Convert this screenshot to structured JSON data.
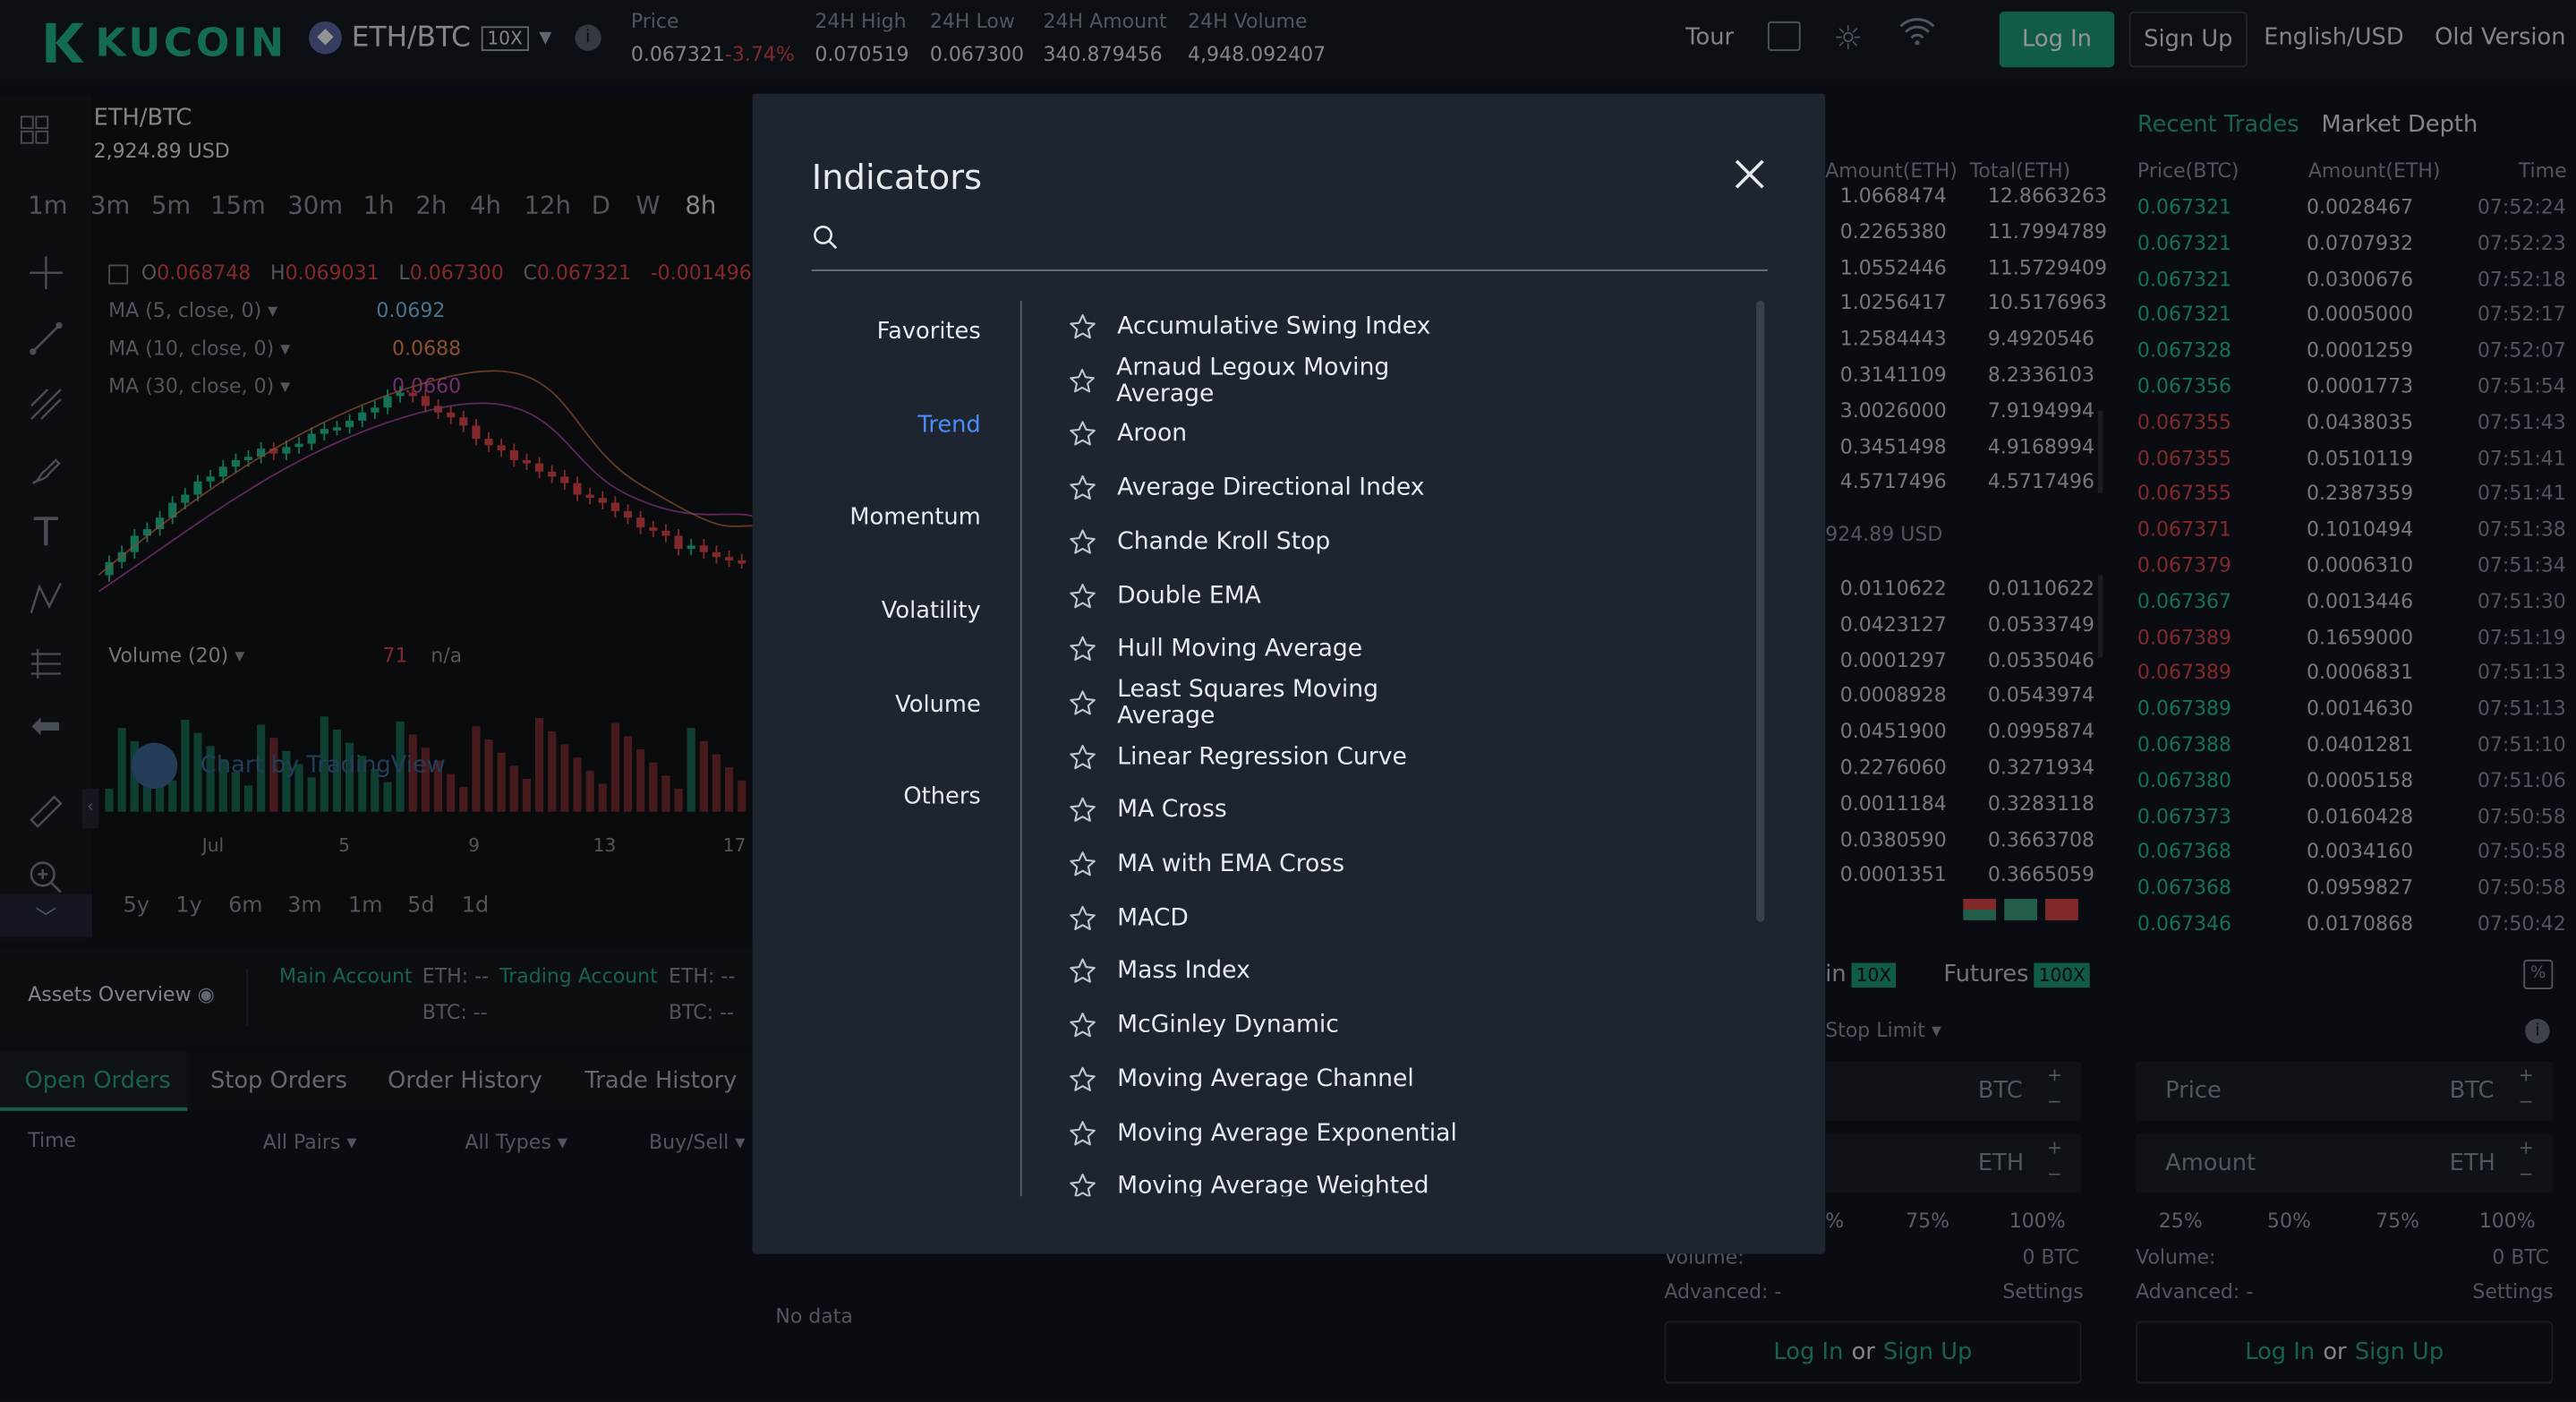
{
  "header": {
    "logo": "KUCOIN",
    "pair": "ETH/BTC",
    "leverage": "10X",
    "stats": [
      {
        "label": "Price",
        "value": "0.067321",
        "extra": "-3.74%"
      },
      {
        "label": "24H High",
        "value": "0.070519"
      },
      {
        "label": "24H Low",
        "value": "0.067300"
      },
      {
        "label": "24H Amount",
        "value": "340.879456"
      },
      {
        "label": "24H Volume",
        "value": "4,948.092407"
      }
    ],
    "tour": "Tour",
    "login": "Log In",
    "signup": "Sign Up",
    "language": "English/USD",
    "old_version": "Old Version"
  },
  "chart": {
    "pair": "ETH/BTC",
    "usd": "2,924.89 USD",
    "timeframes": [
      "1m",
      "3m",
      "5m",
      "15m",
      "30m",
      "1h",
      "2h",
      "4h",
      "12h",
      "D",
      "W",
      "8h"
    ],
    "ohlc": {
      "o": "0.068748",
      "h": "0.069031",
      "l": "0.067300",
      "c": "0.067321",
      "chg": "-0.001496 ("
    },
    "ma": [
      {
        "label": "MA (5, close, 0)",
        "value": "0.0692"
      },
      {
        "label": "MA (10, close, 0)",
        "value": "0.0688"
      },
      {
        "label": "MA (30, close, 0)",
        "value": "0.0660"
      }
    ],
    "volume_label": "Volume (20)",
    "volume_value": "71",
    "volume_na": "n/a",
    "watermark": "Chart by TradingView",
    "x_ticks": [
      "Jul",
      "5",
      "9",
      "13",
      "17"
    ],
    "ranges": [
      "5y",
      "1y",
      "6m",
      "3m",
      "1m",
      "5d",
      "1d"
    ]
  },
  "assets": {
    "overview": "Assets Overview",
    "main_account": "Main Account",
    "trading_account": "Trading Account",
    "eth1": "ETH: --",
    "btc1": "BTC: --",
    "eth2": "ETH: --",
    "btc2": "BTC: --"
  },
  "orders": {
    "tabs": [
      "Open Orders",
      "Stop Orders",
      "Order History",
      "Trade History"
    ],
    "cols": [
      "Time",
      "All Pairs",
      "All Types",
      "Buy/Sell"
    ],
    "empty": "No data"
  },
  "modal": {
    "title": "Indicators",
    "search_placeholder": "",
    "categories": [
      "Favorites",
      "Trend",
      "Momentum",
      "Volatility",
      "Volume",
      "Others"
    ],
    "active_category": "Trend",
    "indicators": [
      "Accumulative Swing Index",
      "Arnaud Legoux Moving Average",
      "Aroon",
      "Average Directional Index",
      "Chande Kroll Stop",
      "Double EMA",
      "Hull Moving Average",
      "Least Squares Moving Average",
      "Linear Regression Curve",
      "MA Cross",
      "MA with EMA Cross",
      "MACD",
      "Mass Index",
      "McGinley Dynamic",
      "Moving Average Channel",
      "Moving Average Exponential",
      "Moving Average Weighted"
    ]
  },
  "orderbook": {
    "headers": [
      "Amount(ETH)",
      "Total(ETH)"
    ],
    "asks": [
      [
        "1.0668474",
        "12.8663263"
      ],
      [
        "0.2265380",
        "11.7994789"
      ],
      [
        "1.0552446",
        "11.5729409"
      ],
      [
        "1.0256417",
        "10.5176963"
      ],
      [
        "1.2584443",
        "9.4920546"
      ],
      [
        "0.3141109",
        "8.2336103"
      ],
      [
        "3.0026000",
        "7.9194994"
      ],
      [
        "0.3451498",
        "4.9168994"
      ],
      [
        "4.5717496",
        "4.5717496"
      ]
    ],
    "mid_usd": "924.89 USD",
    "bids": [
      [
        "0.0110622",
        "0.0110622"
      ],
      [
        "0.0423127",
        "0.0533749"
      ],
      [
        "0.0001297",
        "0.0535046"
      ],
      [
        "0.0008928",
        "0.0543974"
      ],
      [
        "0.0451900",
        "0.0995874"
      ],
      [
        "0.2276060",
        "0.3271934"
      ],
      [
        "0.0011184",
        "0.3283118"
      ],
      [
        "0.0380590",
        "0.3663708"
      ],
      [
        "0.0001351",
        "0.3665059"
      ]
    ]
  },
  "trades": {
    "tabs": [
      "Recent Trades",
      "Market Depth"
    ],
    "headers": [
      "Price(BTC)",
      "Amount(ETH)",
      "Time"
    ],
    "rows": [
      {
        "p": "0.067321",
        "a": "0.0028467",
        "t": "07:52:24",
        "side": "buy"
      },
      {
        "p": "0.067321",
        "a": "0.0707932",
        "t": "07:52:23",
        "side": "buy"
      },
      {
        "p": "0.067321",
        "a": "0.0300676",
        "t": "07:52:18",
        "side": "buy"
      },
      {
        "p": "0.067321",
        "a": "0.0005000",
        "t": "07:52:17",
        "side": "buy"
      },
      {
        "p": "0.067328",
        "a": "0.0001259",
        "t": "07:52:07",
        "side": "buy"
      },
      {
        "p": "0.067356",
        "a": "0.0001773",
        "t": "07:51:54",
        "side": "buy"
      },
      {
        "p": "0.067355",
        "a": "0.0438035",
        "t": "07:51:43",
        "side": "sell"
      },
      {
        "p": "0.067355",
        "a": "0.0510119",
        "t": "07:51:41",
        "side": "sell"
      },
      {
        "p": "0.067355",
        "a": "0.2387359",
        "t": "07:51:41",
        "side": "sell"
      },
      {
        "p": "0.067371",
        "a": "0.1010494",
        "t": "07:51:38",
        "side": "sell"
      },
      {
        "p": "0.067379",
        "a": "0.0006310",
        "t": "07:51:34",
        "side": "sell"
      },
      {
        "p": "0.067367",
        "a": "0.0013446",
        "t": "07:51:30",
        "side": "buy"
      },
      {
        "p": "0.067389",
        "a": "0.1659000",
        "t": "07:51:19",
        "side": "sell"
      },
      {
        "p": "0.067389",
        "a": "0.0006831",
        "t": "07:51:13",
        "side": "sell"
      },
      {
        "p": "0.067389",
        "a": "0.0014630",
        "t": "07:51:13",
        "side": "buy"
      },
      {
        "p": "0.067388",
        "a": "0.0401281",
        "t": "07:51:10",
        "side": "buy"
      },
      {
        "p": "0.067380",
        "a": "0.0005158",
        "t": "07:51:06",
        "side": "buy"
      },
      {
        "p": "0.067373",
        "a": "0.0160428",
        "t": "07:50:58",
        "side": "buy"
      },
      {
        "p": "0.067368",
        "a": "0.0034160",
        "t": "07:50:58",
        "side": "buy"
      },
      {
        "p": "0.067368",
        "a": "0.0959827",
        "t": "07:50:58",
        "side": "buy"
      },
      {
        "p": "0.067346",
        "a": "0.0170868",
        "t": "07:50:42",
        "side": "buy"
      }
    ]
  },
  "trade_form": {
    "tab_margin": "in",
    "margin_badge": "10X",
    "tab_futures": "Futures",
    "futures_badge": "100X",
    "stop_limit": "Stop Limit",
    "left": {
      "price_unit": "BTC",
      "amount_unit": "ETH",
      "pcts": [
        "%",
        "75%",
        "100%"
      ],
      "volume_label": "Volume:",
      "volume_value": "0 BTC",
      "advanced": "Advanced: -",
      "settings": "Settings"
    },
    "right": {
      "price_label": "Price",
      "price_unit": "BTC",
      "amount_label": "Amount",
      "amount_unit": "ETH",
      "pcts": [
        "25%",
        "50%",
        "75%",
        "100%"
      ],
      "volume_label": "Volume:",
      "volume_value": "0 BTC",
      "advanced": "Advanced: -",
      "settings": "Settings"
    },
    "login": "Log In",
    "or": "or",
    "signup": "Sign Up"
  },
  "colors": {
    "green": "#21c397",
    "red": "#e0474a",
    "accent": "#1d9f7e",
    "trend_blue": "#4a8df6"
  }
}
